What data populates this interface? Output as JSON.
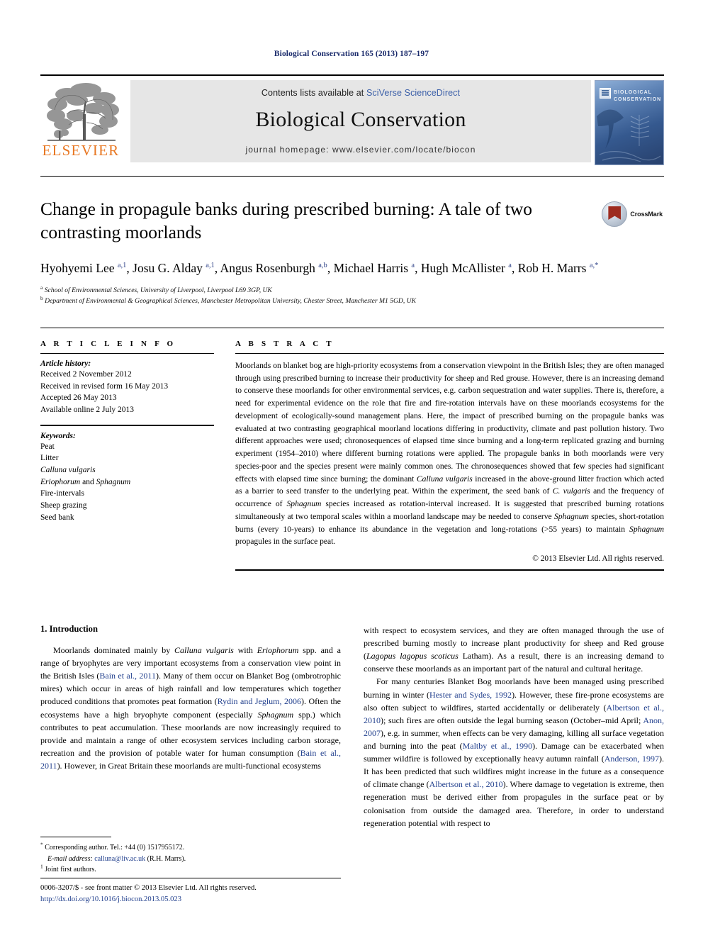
{
  "running_head": "Biological Conservation 165 (2013) 187–197",
  "masthead": {
    "contents_prefix": "Contents lists available at ",
    "contents_link": "SciVerse ScienceDirect",
    "journal_name": "Biological Conservation",
    "homepage": "journal homepage: www.elsevier.com/locate/biocon",
    "publisher_logo_label": "ELSEVIER",
    "cover_title_line1": "BIOLOGICAL",
    "cover_title_line2": "CONSERVATION"
  },
  "crossmark": {
    "label": "CrossMark"
  },
  "article": {
    "title": "Change in propagule banks during prescribed burning: A tale of two contrasting moorlands",
    "authors_html": "Hyohyemi Lee <sup>a,1</sup>, Josu G. Alday <sup>a,1</sup>, Angus Rosenburgh <sup>a,b</sup>, Michael Harris <sup>a</sup>, Hugh McAllister <sup>a</sup>, Rob H. Marrs <sup>a,*</sup>",
    "affiliation_a": "School of Environmental Sciences, University of Liverpool, Liverpool L69 3GP, UK",
    "affiliation_b": "Department of Environmental & Geographical Sciences, Manchester Metropolitan University, Chester Street, Manchester M1 5GD, UK"
  },
  "article_info": {
    "heading": "A R T I C L E  I N F O",
    "history_label": "Article history:",
    "history": [
      "Received 2 November 2012",
      "Received in revised form 16 May 2013",
      "Accepted 26 May 2013",
      "Available online 2 July 2013"
    ],
    "keywords_label": "Keywords:",
    "keywords": [
      "Peat",
      "Litter",
      "Calluna vulgaris",
      "Eriophorum and Sphagnum",
      "Fire-intervals",
      "Sheep grazing",
      "Seed bank"
    ],
    "keywords_italic": [
      false,
      false,
      true,
      "partial",
      false,
      false,
      false
    ]
  },
  "abstract": {
    "heading": "A B S T R A C T",
    "text_html": "Moorlands on blanket bog are high-priority ecosystems from a conservation viewpoint in the British Isles; they are often managed through using prescribed burning to increase their productivity for sheep and Red grouse. However, there is an increasing demand to conserve these moorlands for other environmental services, e.g. carbon sequestration and water supplies. There is, therefore, a need for experimental evidence on the role that fire and fire-rotation intervals have on these moorlands ecosystems for the development of ecologically-sound management plans. Here, the impact of prescribed burning on the propagule banks was evaluated at two contrasting geographical moorland locations differing in productivity, climate and past pollution history. Two different approaches were used; chronosequences of elapsed time since burning and a long-term replicated grazing and burning experiment (1954–2010) where different burning rotations were applied. The propagule banks in both moorlands were very species-poor and the species present were mainly common ones. The chronosequences showed that few species had significant effects with elapsed time since burning; the dominant <em>Calluna vulgaris</em> increased in the above-ground litter fraction which acted as a barrier to seed transfer to the underlying peat. Within the experiment, the seed bank of <em>C. vulgaris</em> and the frequency of occurrence of <em>Sphagnum</em> species increased as rotation-interval increased. It is suggested that prescribed burning rotations simultaneously at two temporal scales within a moorland landscape may be needed to conserve <em>Sphagnum</em> species, short-rotation burns (every 10-years) to enhance its abundance in the vegetation and long-rotations (&gt;55 years) to maintain <em>Sphagnum</em> propagules in the surface peat.",
    "copyright": "© 2013 Elsevier Ltd. All rights reserved."
  },
  "introduction": {
    "heading": "1. Introduction",
    "left_paragraph_html": "Moorlands dominated mainly by <em>Calluna vulgaris</em> with <em>Eriophorum</em> spp. and a range of bryophytes are very important ecosystems from a conservation view point in the British Isles (<span class=\"ref\">Bain et al., 2011</span>). Many of them occur on Blanket Bog (ombrotrophic mires) which occur in areas of high rainfall and low temperatures which together produced conditions that promotes peat formation (<span class=\"ref\">Rydin and Jeglum, 2006</span>). Often the ecosystems have a high bryophyte component (especially <em>Sphagnum</em> spp.) which contributes to peat accumulation. These moorlands are now increasingly required to provide and maintain a range of other ecosystem services including carbon storage, recreation and the provision of potable water for human consumption (<span class=\"ref\">Bain et al., 2011</span>). However, in Great Britain these moorlands are multi-functional ecosystems",
    "right_paragraph1_html": "with respect to ecosystem services, and they are often managed through the use of prescribed burning mostly to increase plant productivity for sheep and Red grouse (<em>Lagopus lagopus scoticus</em> Latham). As a result, there is an increasing demand to conserve these moorlands as an important part of the natural and cultural heritage.",
    "right_paragraph2_html": "For many centuries Blanket Bog moorlands have been managed using prescribed burning in winter (<span class=\"ref\">Hester and Sydes, 1992</span>). However, these fire-prone ecosystems are also often subject to wildfires, started accidentally or deliberately (<span class=\"ref\">Albertson et al., 2010</span>); such fires are often outside the legal burning season (October–mid April; <span class=\"ref\">Anon, 2007</span>), e.g. in summer, when effects can be very damaging, killing all surface vegetation and burning into the peat (<span class=\"ref\">Maltby et al., 1990</span>). Damage can be exacerbated when summer wildfire is followed by exceptionally heavy autumn rainfall (<span class=\"ref\">Anderson, 1997</span>). It has been predicted that such wildfires might increase in the future as a consequence of climate change (<span class=\"ref\">Albertson et al., 2010</span>). Where damage to vegetation is extreme, then regeneration must be derived either from propagules in the surface peat or by colonisation from outside the damaged area. Therefore, in order to understand regeneration potential with respect to"
  },
  "footnotes": {
    "corresponding_html": "<span class=\"fn-sup\">*</span> Corresponding author. Tel.: +44 (0) 1517955172.",
    "email_html": "<em>E-mail address:</em> <span class=\"mail\">calluna@liv.ac.uk</span> (R.H. Marrs).",
    "joint_html": "<span class=\"fn-sup\">1</span> Joint first authors."
  },
  "bottom": {
    "front_matter": "0006-3207/$ - see front matter © 2013 Elsevier Ltd. All rights reserved.",
    "doi": "http://dx.doi.org/10.1016/j.biocon.2013.05.023"
  },
  "colors": {
    "link_blue": "#23418e",
    "running_head_blue": "#1a2a6b",
    "elsevier_orange": "#E87722",
    "band_gray": "#e6e6e6"
  }
}
